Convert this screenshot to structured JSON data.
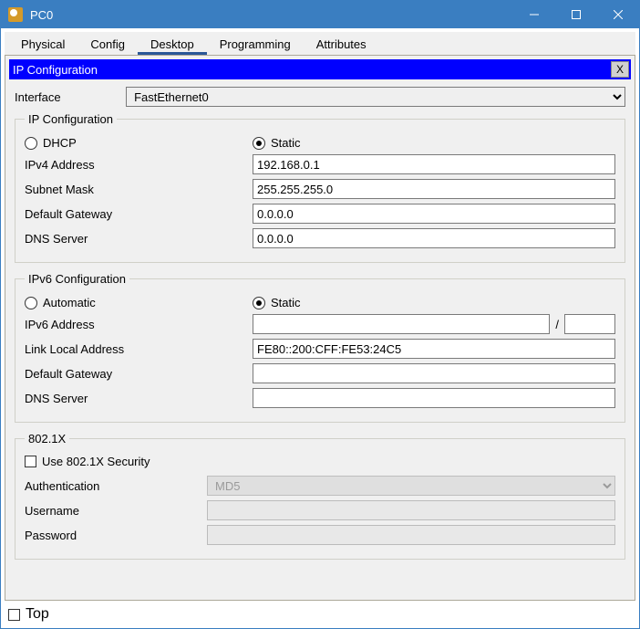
{
  "window": {
    "title": "PC0"
  },
  "tabs": [
    "Physical",
    "Config",
    "Desktop",
    "Programming",
    "Attributes"
  ],
  "active_tab": "Desktop",
  "panel": {
    "title": "IP Configuration",
    "close": "X"
  },
  "interface": {
    "label": "Interface",
    "value": "FastEthernet0"
  },
  "ipv4": {
    "legend": "IP Configuration",
    "mode_dhcp": "DHCP",
    "mode_static": "Static",
    "selected": "Static",
    "addr_label": "IPv4 Address",
    "addr": "192.168.0.1",
    "mask_label": "Subnet Mask",
    "mask": "255.255.255.0",
    "gw_label": "Default Gateway",
    "gw": "0.0.0.0",
    "dns_label": "DNS Server",
    "dns": "0.0.0.0"
  },
  "ipv6": {
    "legend": "IPv6 Configuration",
    "mode_auto": "Automatic",
    "mode_static": "Static",
    "selected": "Static",
    "addr_label": "IPv6 Address",
    "addr": "",
    "prefix": "",
    "ll_label": "Link Local Address",
    "ll": "FE80::200:CFF:FE53:24C5",
    "gw_label": "Default Gateway",
    "gw": "",
    "dns_label": "DNS Server",
    "dns": ""
  },
  "dot1x": {
    "legend": "802.1X",
    "use_label": "Use 802.1X Security",
    "use_checked": false,
    "auth_label": "Authentication",
    "auth_value": "MD5",
    "user_label": "Username",
    "user_value": "",
    "pass_label": "Password",
    "pass_value": ""
  },
  "bottom": {
    "top_label": "Top",
    "top_checked": false
  },
  "slash": "/"
}
